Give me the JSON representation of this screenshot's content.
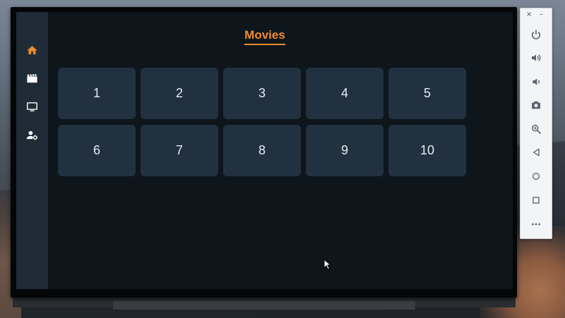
{
  "screen": {
    "title": "Movies",
    "accent_color": "#ef8a2c",
    "tiles": [
      "1",
      "2",
      "3",
      "4",
      "5",
      "6",
      "7",
      "8",
      "9",
      "10"
    ]
  },
  "sidebar": {
    "items": [
      {
        "icon": "home-icon",
        "active": true
      },
      {
        "icon": "movie-icon",
        "active": false
      },
      {
        "icon": "tv-icon",
        "active": false
      },
      {
        "icon": "user-settings-icon",
        "active": false
      }
    ]
  },
  "emulator_toolbar": {
    "close_label": "×",
    "minimize_label": "–",
    "buttons": [
      "power-icon",
      "volume-up-icon",
      "volume-down-icon",
      "camera-icon",
      "zoom-in-icon",
      "back-icon",
      "home-circle-icon",
      "overview-icon",
      "more-icon"
    ]
  }
}
